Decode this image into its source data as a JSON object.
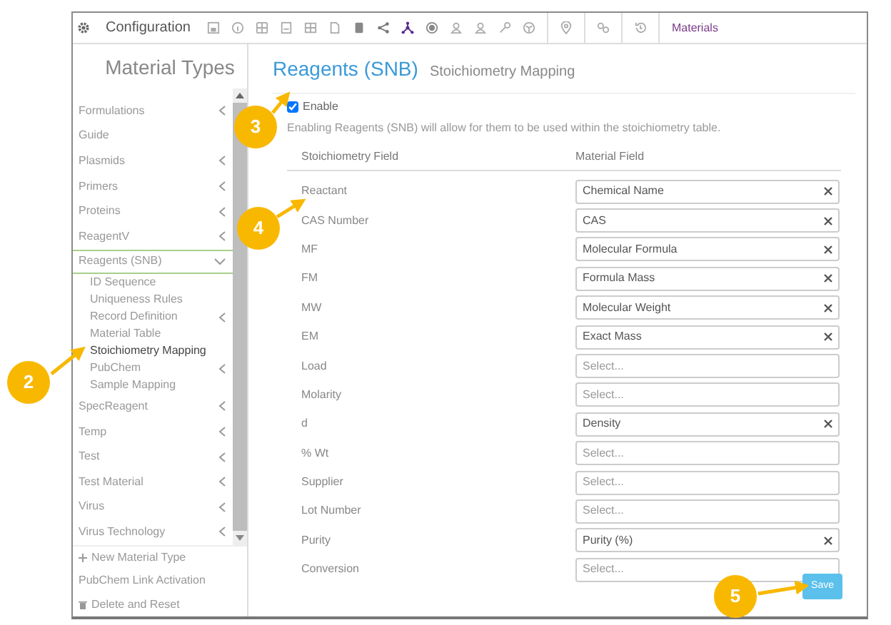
{
  "toolbar": {
    "title": "Configuration",
    "breadcrumb": "Materials"
  },
  "sidebar": {
    "title": "Material Types",
    "items": [
      {
        "label": "Formulations",
        "expandable": true,
        "expanded": false,
        "selected": false
      },
      {
        "label": "Guide",
        "expandable": false,
        "expanded": false,
        "selected": false
      },
      {
        "label": "Plasmids",
        "expandable": true,
        "expanded": false,
        "selected": false
      },
      {
        "label": "Primers",
        "expandable": true,
        "expanded": false,
        "selected": false
      },
      {
        "label": "Proteins",
        "expandable": true,
        "expanded": false,
        "selected": false
      },
      {
        "label": "ReagentV",
        "expandable": true,
        "expanded": false,
        "selected": false
      },
      {
        "label": "Reagents (SNB)",
        "expandable": true,
        "expanded": true,
        "selected": false,
        "children": [
          {
            "label": "ID Sequence",
            "expandable": false,
            "selected": false
          },
          {
            "label": "Uniqueness Rules",
            "expandable": false,
            "selected": false
          },
          {
            "label": "Record Definition",
            "expandable": true,
            "selected": false
          },
          {
            "label": "Material Table",
            "expandable": false,
            "selected": false
          },
          {
            "label": "Stoichiometry Mapping",
            "expandable": false,
            "selected": true
          },
          {
            "label": "PubChem",
            "expandable": true,
            "selected": false
          },
          {
            "label": "Sample Mapping",
            "expandable": false,
            "selected": false
          }
        ]
      },
      {
        "label": "SpecReagent",
        "expandable": true,
        "expanded": false,
        "selected": false
      },
      {
        "label": "Temp",
        "expandable": true,
        "expanded": false,
        "selected": false
      },
      {
        "label": "Test",
        "expandable": true,
        "expanded": false,
        "selected": false
      },
      {
        "label": "Test Material",
        "expandable": true,
        "expanded": false,
        "selected": false
      },
      {
        "label": "Virus",
        "expandable": true,
        "expanded": false,
        "selected": false
      },
      {
        "label": "Virus Technology",
        "expandable": true,
        "expanded": false,
        "selected": false
      }
    ],
    "actions": [
      {
        "kind": "add",
        "label": "New Material Type"
      },
      {
        "kind": "plain",
        "label": "PubChem Link Activation"
      },
      {
        "kind": "delete",
        "label": "Delete and Reset"
      }
    ]
  },
  "content": {
    "title": "Reagents (SNB)",
    "subtitle": "Stoichiometry Mapping",
    "enable": {
      "label": "Enable",
      "checked": true
    },
    "description": "Enabling Reagents (SNB) will allow for them to be used within the stoichiometry table.",
    "columns": [
      "Stoichiometry Field",
      "Material Field"
    ],
    "rows": [
      {
        "field": "Reactant",
        "value": "Chemical Name"
      },
      {
        "field": "CAS Number",
        "value": "CAS"
      },
      {
        "field": "MF",
        "value": "Molecular Formula"
      },
      {
        "field": "FM",
        "value": "Formula Mass"
      },
      {
        "field": "MW",
        "value": "Molecular Weight"
      },
      {
        "field": "EM",
        "value": "Exact Mass"
      },
      {
        "field": "Load",
        "placeholder": "Select..."
      },
      {
        "field": "Molarity",
        "placeholder": "Select..."
      },
      {
        "field": "d",
        "value": "Density"
      },
      {
        "field": "% Wt",
        "placeholder": "Select..."
      },
      {
        "field": "Supplier",
        "placeholder": "Select..."
      },
      {
        "field": "Lot Number",
        "placeholder": "Select..."
      },
      {
        "field": "Purity",
        "value": "Purity (%)"
      },
      {
        "field": "Conversion",
        "placeholder": "Select..."
      }
    ],
    "save": "Save"
  },
  "callouts": [
    {
      "number": "2"
    },
    {
      "number": "3"
    },
    {
      "number": "4"
    },
    {
      "number": "5"
    }
  ]
}
